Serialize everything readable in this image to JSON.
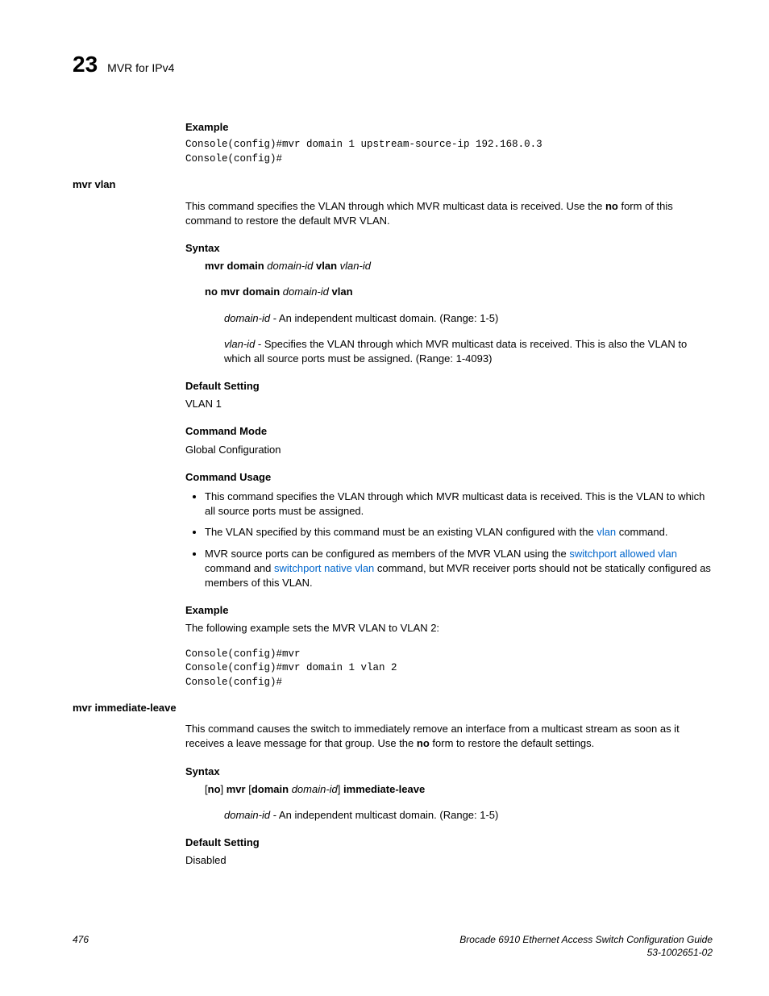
{
  "header": {
    "chapter_num": "23",
    "chapter_title": "MVR for IPv4"
  },
  "sections": {
    "example1": {
      "heading": "Example",
      "code": "Console(config)#mvr domain 1 upstream-source-ip 192.168.0.3\nConsole(config)#"
    },
    "mvr_vlan": {
      "side_label": "mvr vlan",
      "intro_pre": "This command specifies the VLAN through which MVR multicast data is received. Use the ",
      "intro_bold": "no",
      "intro_post": " form of this command to restore the default MVR VLAN.",
      "syntax": {
        "heading": "Syntax",
        "line1_a": "mvr domain ",
        "line1_b": "domain-id",
        "line1_c": " vlan ",
        "line1_d": "vlan-id",
        "line2_a": "no mvr domain ",
        "line2_b": "domain-id",
        "line2_c": " vlan",
        "param1_a": "domain-id",
        "param1_b": " - An independent multicast domain. (Range: 1-5)",
        "param2_a": "vlan-id",
        "param2_b": " - Specifies the VLAN through which MVR multicast data is received. This is also the VLAN to which all source ports must be assigned. (Range: 1-4093)"
      },
      "default": {
        "heading": "Default Setting",
        "value": "VLAN 1"
      },
      "mode": {
        "heading": "Command Mode",
        "value": "Global Configuration"
      },
      "usage": {
        "heading": "Command Usage",
        "b1": "This command specifies the VLAN through which MVR multicast data is received. This is the VLAN to which all source ports must be assigned.",
        "b2_a": "The VLAN specified by this command must be an existing VLAN configured with the ",
        "b2_link": "vlan",
        "b2_b": " command.",
        "b3_a": "MVR source ports can be configured as members of the MVR VLAN using the ",
        "b3_link1": "switchport allowed vlan",
        "b3_b": " command and ",
        "b3_link2": "switchport native vlan",
        "b3_c": " command, but MVR receiver ports should not be statically configured as members of this VLAN."
      },
      "example": {
        "heading": "Example",
        "intro": "The following example sets the MVR VLAN to VLAN 2:",
        "code": "Console(config)#mvr\nConsole(config)#mvr domain 1 vlan 2\nConsole(config)#"
      }
    },
    "mvr_immediate": {
      "side_label": "mvr immediate-leave",
      "intro_pre": "This command causes the switch to immediately remove an interface from a multicast stream as soon as it receives a leave message for that group. Use the ",
      "intro_bold": "no",
      "intro_post": " form to restore the default settings.",
      "syntax": {
        "heading": "Syntax",
        "line_a": "[",
        "line_b": "no",
        "line_c": "] ",
        "line_d": "mvr",
        "line_e": " [",
        "line_f": "domain",
        "line_g": " ",
        "line_h": "domain-id",
        "line_i": "] ",
        "line_j": "immediate-leave",
        "param_a": "domain-id",
        "param_b": " - An independent multicast domain. (Range: 1-5)"
      },
      "default": {
        "heading": "Default Setting",
        "value": "Disabled"
      }
    }
  },
  "footer": {
    "page": "476",
    "title": "Brocade 6910 Ethernet Access Switch Configuration Guide",
    "docnum": "53-1002651-02"
  }
}
